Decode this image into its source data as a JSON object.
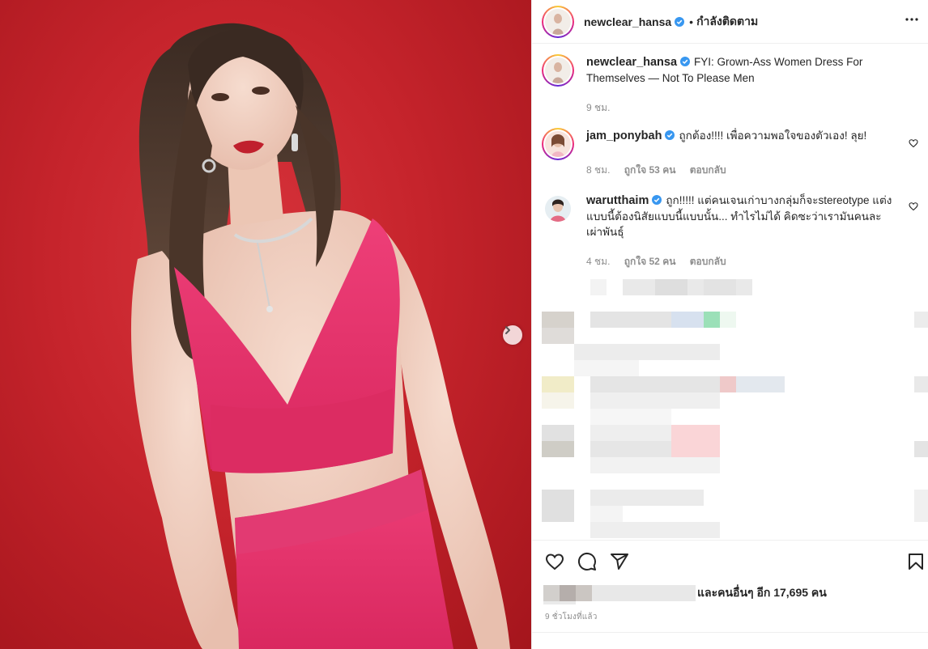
{
  "post": {
    "username": "newclear_hansa",
    "follow_status": "กำลังติดตาม",
    "dot": "•"
  },
  "caption": {
    "username": "newclear_hansa",
    "text": "FYI: Grown-Ass Women Dress For Themselves — Not To Please Men",
    "time": "9 ชม."
  },
  "comments": [
    {
      "username": "jam_ponybah",
      "text": "ถูกต้อง!!!! เพื่อความพอใจของตัวเอง! ลุย!",
      "time": "8 ชม.",
      "likes": "ถูกใจ 53 คน",
      "reply": "ตอบกลับ"
    },
    {
      "username": "warutthaim",
      "text": "ถูก!!!!! แต่คนเจนเก่าบางกลุ่มก็จะstereotype แต่งแบบนี้ต้องนิสัยแบบนี้แบบนั้น... ทำไรไม่ได้ คิดซะว่าเรามันคนละเผ่าพันธุ์",
      "time": "4 ชม.",
      "likes": "ถูกใจ 52 คน",
      "reply": "ตอบกลับ"
    }
  ],
  "likes_text": "และคนอื่นๆ อีก 17,695 คน",
  "time_ago": "9 ชั่วโมงที่แล้ว",
  "icons": {
    "verified": "verified-badge-icon",
    "more": "more-options-icon",
    "next": "chevron-right-icon",
    "like": "heart-icon",
    "comment": "comment-icon",
    "share": "paper-plane-icon",
    "save": "bookmark-icon"
  },
  "colors": {
    "verified": "#3897f0",
    "background_red": "#c6242c",
    "dress_pink": "#e8336e"
  }
}
